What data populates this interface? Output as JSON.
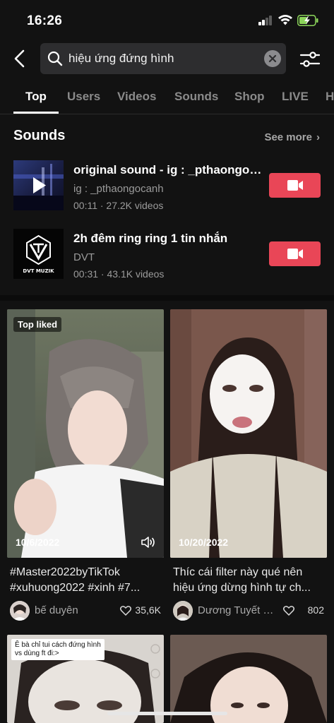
{
  "status": {
    "time": "16:26"
  },
  "search": {
    "query": "hiệu ứng đứng hình"
  },
  "tabs": [
    {
      "label": "Top"
    },
    {
      "label": "Users"
    },
    {
      "label": "Videos"
    },
    {
      "label": "Sounds"
    },
    {
      "label": "Shop"
    },
    {
      "label": "LIVE"
    },
    {
      "label": "H"
    }
  ],
  "sounds": {
    "title": "Sounds",
    "see_more": "See more",
    "items": [
      {
        "title": "original sound - ig : _pthaongocanh",
        "artist": "ig : _pthaongocanh",
        "meta": "00:11 · 27.2K videos"
      },
      {
        "title": "2h đêm ring ring 1 tin nhắn",
        "artist": "DVT",
        "meta": "00:31 · 43.1K videos",
        "cover_text": "DVT MUZIK"
      }
    ]
  },
  "videos": [
    {
      "badge": "Top liked",
      "date": "10/6/2022",
      "desc_line1": "#Master2022byTikTok",
      "desc_line2": "#xuhuong2022 #xinh #7...",
      "author": "bế duyên",
      "likes": "35,6K"
    },
    {
      "badge": "",
      "date": "10/20/2022",
      "desc_line1": "Thíc cái filter này qué nên",
      "desc_line2": "hiệu ứng dừng hình tự ch...",
      "author": "Dương Tuyết M...",
      "likes": "802"
    },
    {
      "caption": "Ê bà chỉ tui cách đứng hình vs dùng ft đi:>"
    },
    {}
  ],
  "colors": {
    "background": "#121212",
    "accent": "#e94657",
    "muted": "#8a8a8a"
  }
}
